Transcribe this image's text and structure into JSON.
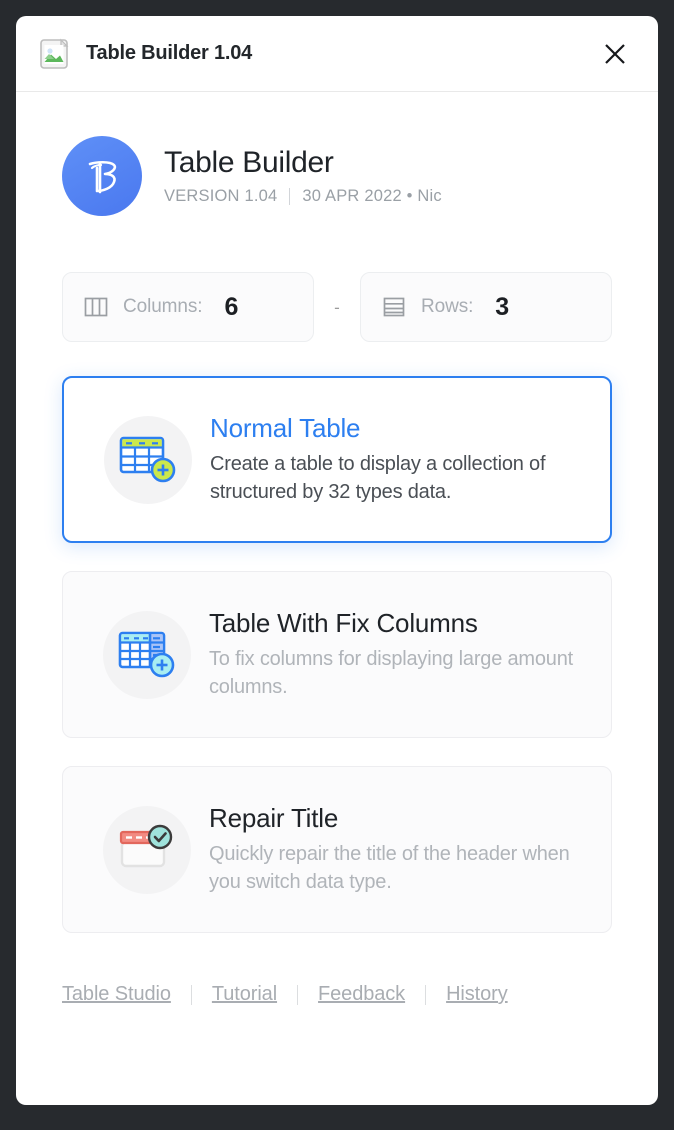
{
  "window": {
    "titlebar": {
      "icon": "image-placeholder-icon",
      "title": "Table Builder 1.04",
      "close_label": "✕"
    }
  },
  "app_header": {
    "logo_icon": "table-builder-logo",
    "name": "Table Builder",
    "version": "VERSION 1.04",
    "date_author": "30 APR 2022 • Nic"
  },
  "size_controls": {
    "columns": {
      "icon": "columns-icon",
      "label": "Columns:",
      "value": "6"
    },
    "separator": "-",
    "rows": {
      "icon": "rows-icon",
      "label": "Rows:",
      "value": "3"
    }
  },
  "options": [
    {
      "icon": "normal-table-icon",
      "title": "Normal Table",
      "description": "Create a table to display a collection of structured by 32 types data.",
      "selected": true
    },
    {
      "icon": "fix-columns-table-icon",
      "title": "Table With Fix Columns",
      "description": "To fix columns for displaying large amount columns.",
      "selected": false
    },
    {
      "icon": "repair-title-icon",
      "title": "Repair Title",
      "description": "Quickly repair the title of the header when you switch data type.",
      "selected": false
    }
  ],
  "footer": {
    "links": [
      {
        "label": "Table Studio"
      },
      {
        "label": "Tutorial"
      },
      {
        "label": "Feedback"
      },
      {
        "label": "History"
      }
    ]
  },
  "colors": {
    "accent_blue": "#2d7ff0",
    "logo_blue": "#4a78ef",
    "page_background": "#272a2e",
    "muted_text": "#b0b4b9",
    "icon_green": "#cbe84b",
    "icon_teal": "#9fe3dc",
    "icon_red": "#f28b82"
  }
}
